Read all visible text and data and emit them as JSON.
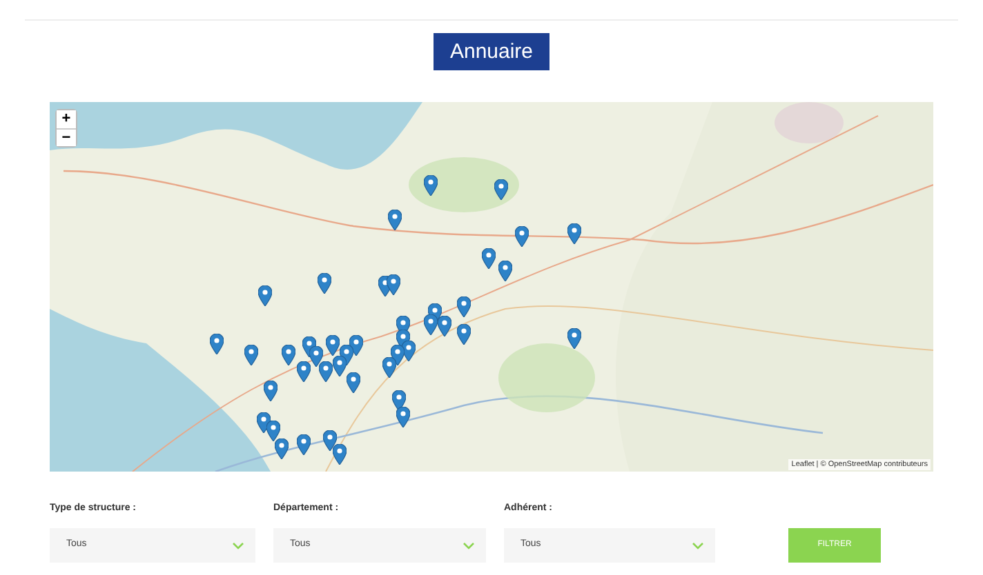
{
  "header": {
    "title": "Annuaire"
  },
  "map": {
    "zoom_in": "+",
    "zoom_out": "−",
    "attribution": "Leaflet | © OpenStreetMap contributeurs"
  },
  "filters": [
    {
      "label": "Type de structure :",
      "value": "Tous"
    },
    {
      "label": "Département :",
      "value": "Tous"
    },
    {
      "label": "Adhérent :",
      "value": "Tous"
    }
  ],
  "submit": {
    "label": "FILTRER"
  }
}
